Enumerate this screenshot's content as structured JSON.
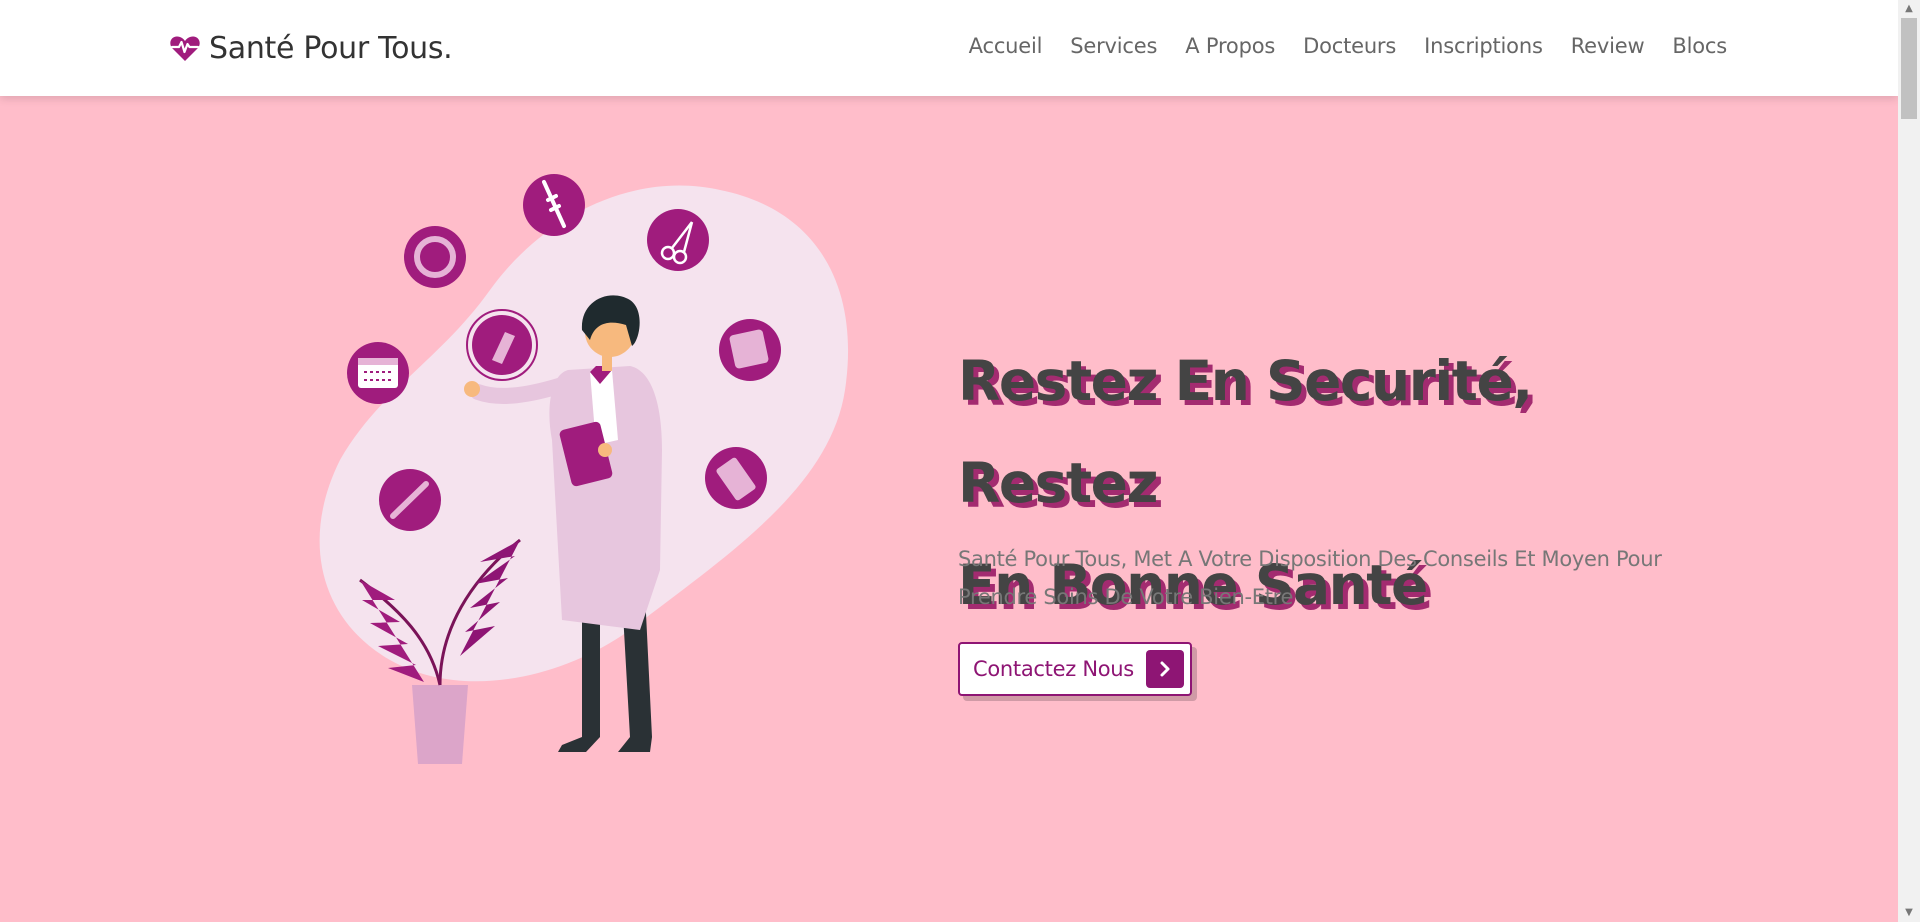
{
  "header": {
    "brand": "Santé Pour Tous.",
    "nav": [
      "Accueil",
      "Services",
      "A Propos",
      "Docteurs",
      "Inscriptions",
      "Review",
      "Blocs"
    ]
  },
  "hero": {
    "title_line1": "Restez En Securité, Restez",
    "title_line2": "En Bonne Santé",
    "description": "Santé Pour Tous, Met A Votre Disposition Des Conseils Et Moyen Pour Prendre Soins De Votre Bien-Etre",
    "button_label": "Contactez Nous",
    "button_icon": "chevron-right-icon"
  },
  "colors": {
    "background": "#ffbdca",
    "accent": "#8e1574",
    "title_shadow": "#a32b70",
    "blob": "#f5e3ee"
  },
  "icons": [
    "heart-pulse-logo-icon",
    "syringe-icon",
    "ring-icon",
    "scissors-icon",
    "calendar-icon",
    "pill-icon",
    "bandage-icon",
    "tablet-pack-icon",
    "thermometer-icon",
    "scroll-up-icon",
    "scroll-down-icon"
  ]
}
